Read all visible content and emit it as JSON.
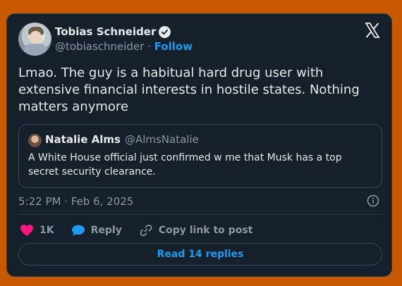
{
  "tweet": {
    "author_name": "Tobias Schneider",
    "author_handle": "@tobiaschneider",
    "separator": "·",
    "follow_label": "Follow",
    "text": "Lmao. The guy is a habitual hard drug user with extensive financial interests in hostile states. Nothing matters anymore",
    "timestamp": "5:22 PM · Feb 6, 2025"
  },
  "quote": {
    "author_name": "Natalie Alms",
    "author_handle": "@AlmsNatalie",
    "text": "A White House official just confirmed w me that Musk has a top secret security clearance."
  },
  "actions": {
    "like_count": "1K",
    "reply_label": "Reply",
    "copy_label": "Copy link to post"
  },
  "read_replies_label": "Read 14 replies",
  "colors": {
    "background": "#c75a00",
    "card": "#15202b",
    "accent": "#1d9bf0",
    "like": "#f91880"
  },
  "icons": [
    "verified-icon",
    "x-logo-icon",
    "info-icon",
    "heart-icon",
    "reply-icon",
    "link-icon"
  ]
}
